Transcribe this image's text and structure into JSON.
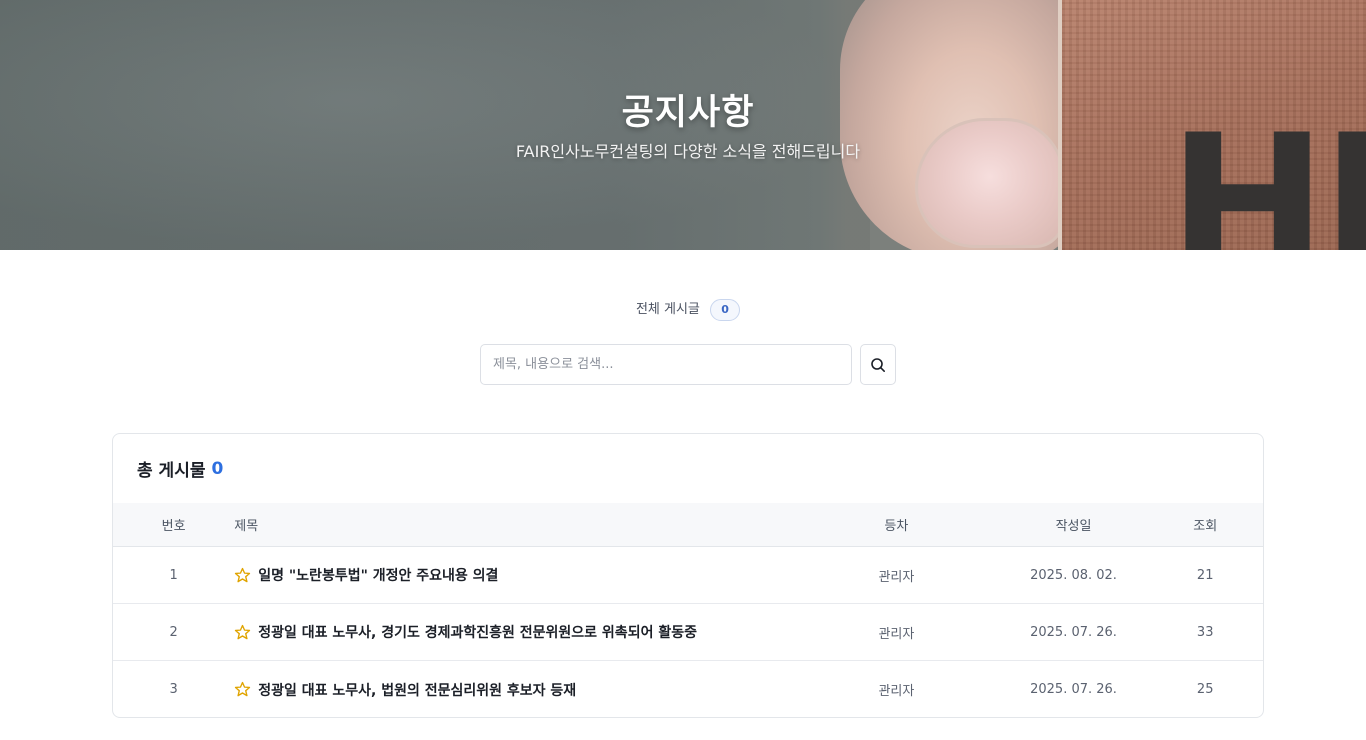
{
  "hero": {
    "title": "공지사항",
    "subtitle": "FAIR인사노무컨설팅의 다양한 소식을 전해드립니다",
    "image_letters": "HR"
  },
  "summary": {
    "label": "전체 게시글",
    "count": "0"
  },
  "search": {
    "placeholder": "제목, 내용으로 검색...",
    "icon": "search-icon"
  },
  "board": {
    "heading": "총 게시물",
    "total": "0",
    "columns": {
      "no": "번호",
      "title": "제목",
      "author": "등차",
      "date": "작성일",
      "views": "조회"
    },
    "rows": [
      {
        "no": "1",
        "title": "일명 \"노란봉투법\" 개정안 주요내용 의결",
        "author": "관리자",
        "date": "2025. 08. 02.",
        "views": "21",
        "icon": "star-outline-icon"
      },
      {
        "no": "2",
        "title": "정광일 대표 노무사, 경기도 경제과학진흥원 전문위원으로 위촉되어 활동중",
        "author": "관리자",
        "date": "2025. 07. 26.",
        "views": "33",
        "icon": "star-outline-icon"
      },
      {
        "no": "3",
        "title": "정광일 대표 노무사, 법원의 전문심리위원 후보자 등재",
        "author": "관리자",
        "date": "2025. 07. 26.",
        "views": "25",
        "icon": "star-outline-icon"
      }
    ]
  },
  "colors": {
    "accent": "#2d6fe0",
    "star": "#e0a400",
    "border": "#e3e6ea"
  }
}
